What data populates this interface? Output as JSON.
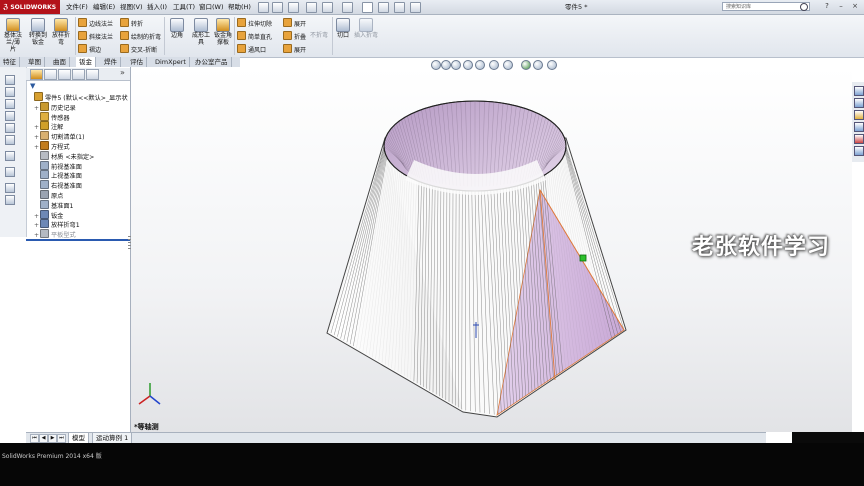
{
  "app": {
    "logo_text": "SOLIDWORKS",
    "document_title": "零件5 *",
    "search_placeholder": "搜索知识库"
  },
  "menu": [
    "文件(F)",
    "编辑(E)",
    "视图(V)",
    "插入(I)",
    "工具(T)",
    "窗口(W)",
    "帮助(H)"
  ],
  "ribbon": {
    "large": [
      "基体法兰/薄片",
      "转换到钣金",
      "放样折弯",
      "边角",
      "成形工具",
      "钣金角撑板",
      "切口",
      "插入折弯"
    ],
    "small": {
      "col1": [
        "边线法兰",
        "斜接法兰",
        "褶边"
      ],
      "col2": [
        "转折",
        "绘制的折弯",
        "交叉-折断"
      ],
      "col3": [
        "拉伸切除",
        "简单直孔",
        "通风口"
      ],
      "col4": [
        "展开",
        "折叠",
        "展开"
      ],
      "col5": [
        "不折弯"
      ]
    }
  },
  "command_tabs": [
    "特征",
    "草图",
    "曲面",
    "钣金",
    "焊件",
    "评估",
    "DimXpert",
    "办公室产品"
  ],
  "active_tab": "钣金",
  "tree": [
    {
      "label": "零件5 (默认<<默认>_显示状",
      "expander": "",
      "color": "#d8a030"
    },
    {
      "label": "历史记录",
      "expander": "+",
      "color": "#c99a2e"
    },
    {
      "label": "传感器",
      "expander": "",
      "color": "#e0b040"
    },
    {
      "label": "注解",
      "expander": "+",
      "color": "#d0a028"
    },
    {
      "label": "切割清单(1)",
      "expander": "+",
      "color": "#d9b070"
    },
    {
      "label": "方程式",
      "expander": "+",
      "color": "#c27c1e"
    },
    {
      "label": "材质 <未指定>",
      "expander": "",
      "color": "#b8bcc4"
    },
    {
      "label": "前视基准面",
      "expander": "",
      "color": "#9fb0c8"
    },
    {
      "label": "上视基准面",
      "expander": "",
      "color": "#9fb0c8"
    },
    {
      "label": "右视基准面",
      "expander": "",
      "color": "#9fb0c8"
    },
    {
      "label": "原点",
      "expander": "",
      "color": "#9aa3b1"
    },
    {
      "label": "基准面1",
      "expander": "",
      "color": "#9fb0c8"
    },
    {
      "label": "钣金",
      "expander": "+",
      "color": "#6d88b6"
    },
    {
      "label": "放样折弯1",
      "expander": "+",
      "color": "#6d88b6"
    },
    {
      "label": "平板型式",
      "expander": "+",
      "color": "#b5bac2",
      "gray": true
    }
  ],
  "watermark": "老张软件学习",
  "view_label": "*等轴测",
  "bottom_tabs": [
    "模型",
    "运动算例 1"
  ],
  "status_text": "SolidWorks Premium 2014 x64 版"
}
